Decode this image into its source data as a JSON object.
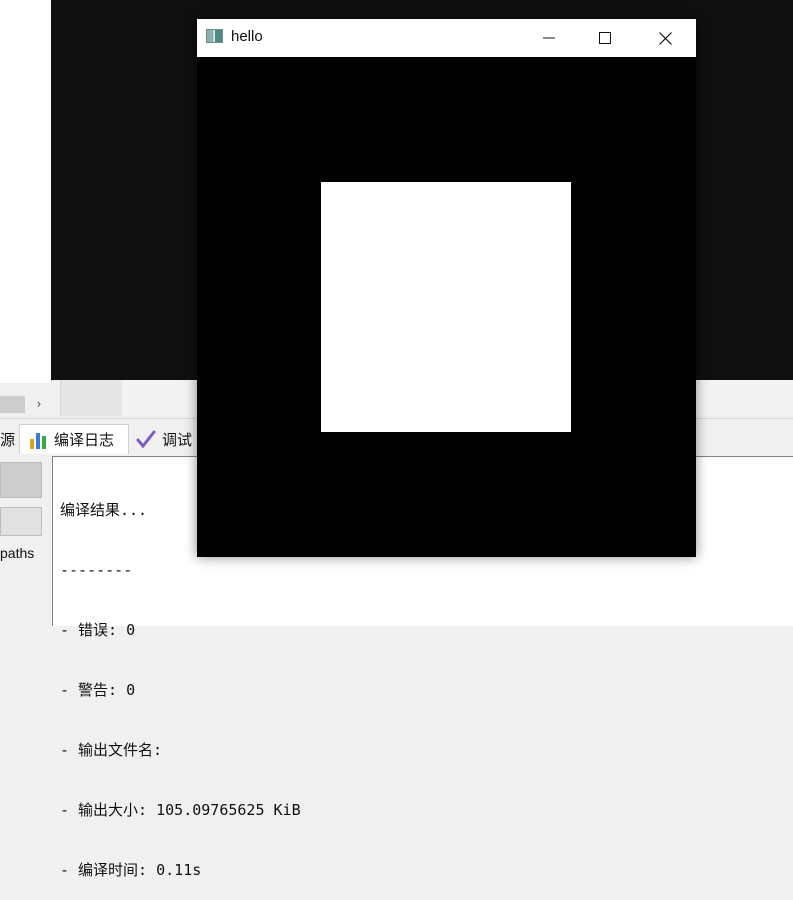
{
  "ide": {
    "tabs": {
      "source_partial": "源",
      "compile_log": "编译日志",
      "debug_partial": "调试"
    },
    "side_label": "paths",
    "log_lines": [
      "编译结果...",
      "--------",
      "- 错误: 0",
      "- 警告: 0",
      "- 输出文件名:",
      "- 输出大小: 105.09765625 KiB",
      "- 编译时间: 0.11s"
    ],
    "scroll_arrow": "›"
  },
  "window": {
    "title": "hello",
    "icons": {
      "app": "app-icon",
      "minimize": "minimize-icon",
      "maximize": "maximize-icon",
      "close": "close-icon"
    },
    "colors": {
      "client_background": "#000000",
      "square": "#ffffff"
    }
  }
}
